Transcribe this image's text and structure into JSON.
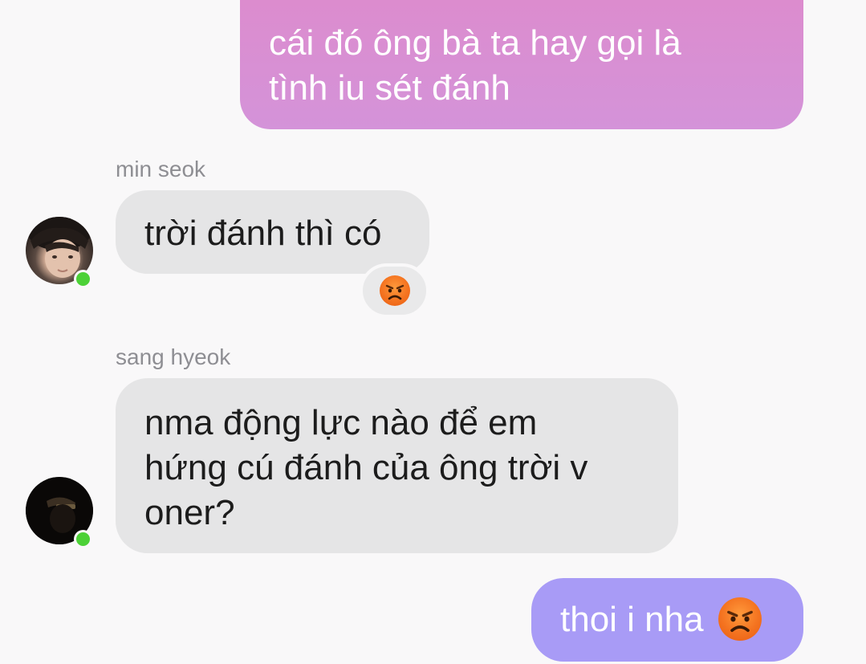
{
  "messages": {
    "sent_1": {
      "line_1": "cái đó ông bà ta hay gọi là",
      "line_2": "tình iu sét đánh"
    },
    "received_1": {
      "sender": "min seok",
      "text": "trời đánh thì có",
      "reaction": "angry-face-emoji",
      "online": true
    },
    "received_2": {
      "sender": "sang hyeok",
      "line_1": "nma động lực nào để em",
      "line_2": "hứng cú đánh của ông trời v",
      "line_3": "oner?",
      "online": true
    },
    "sent_2": {
      "text": "thoi i nha",
      "emoji": "angry-face-emoji"
    }
  },
  "colors": {
    "background": "#f9f8f9",
    "sent_bubble_pink": "#d993d6",
    "sent_bubble_purple": "#a89bf6",
    "received_bubble": "#e5e5e6",
    "online_indicator": "#4cd137",
    "sender_name": "#8e8e93"
  }
}
